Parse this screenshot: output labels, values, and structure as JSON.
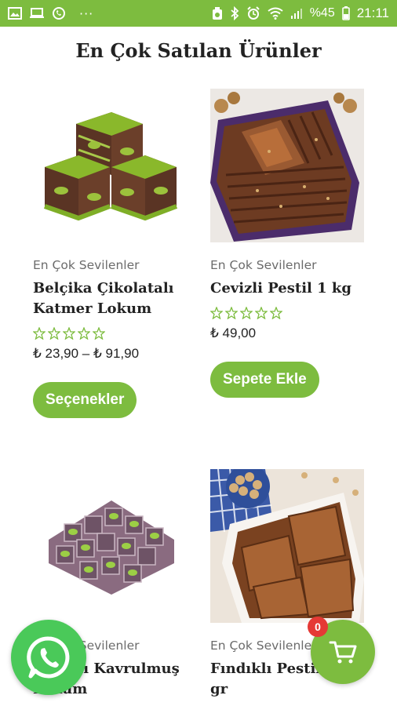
{
  "status_bar": {
    "battery_text": "%45",
    "time": "21:11",
    "more": "···"
  },
  "page": {
    "title": "En Çok Satılan Ürünler"
  },
  "products": [
    {
      "category": "En Çok Sevilenler",
      "name": "Belçika Çikolatalı Katmer Lokum",
      "rating": 0,
      "price": "₺ 23,90 – ₺ 91,90",
      "button": "Seçenekler"
    },
    {
      "category": "En Çok Sevilenler",
      "name": "Cevizli Pestil 1 kg",
      "rating": 0,
      "price": "₺ 49,00",
      "button": "Sepete Ekle"
    },
    {
      "category": "En Çok Sevilenler",
      "name": "Fıstıklı Kavrulmuş Lokum"
    },
    {
      "category": "En Çok Sevilenler",
      "name": "Fındıklı Pestil 1 kg gr"
    }
  ],
  "cart": {
    "count": "0"
  },
  "colors": {
    "brand_green": "#7dbc3f",
    "whatsapp_green": "#4ac959",
    "badge_red": "#e53935"
  }
}
